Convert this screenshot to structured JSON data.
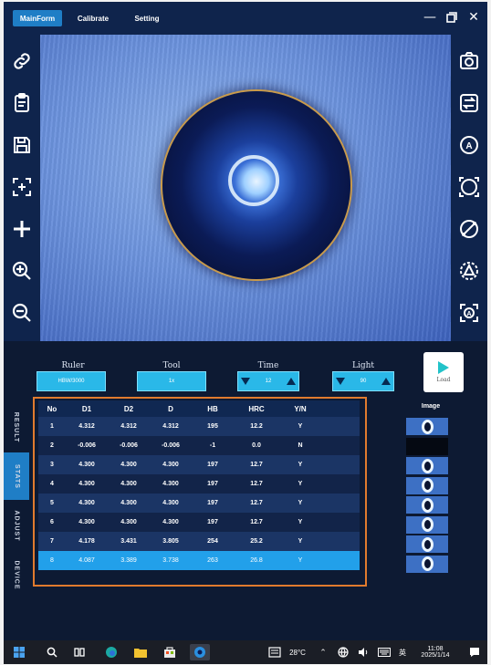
{
  "app": {
    "tabs": [
      "MainForm",
      "Calibrate",
      "Setting"
    ],
    "window_controls": [
      "minimize-icon",
      "maximize-icon",
      "close-icon"
    ]
  },
  "left_toolbar": [
    "link-icon",
    "clipboard-icon",
    "save-icon",
    "crosshair-fit-icon",
    "plus-icon",
    "zoom-in-icon",
    "zoom-out-icon"
  ],
  "right_toolbar": [
    "camera-icon",
    "swap-icon",
    "auto-measure-icon",
    "circle-fit-icon",
    "diameter-icon",
    "triangle-measure-icon",
    "auto-box-icon"
  ],
  "controls": {
    "ruler_label": "Ruler",
    "ruler_value": "HBW/3000",
    "tool_label": "Tool",
    "tool_value": "1x",
    "time_label": "Time",
    "time_value": "12",
    "light_label": "Light",
    "light_value": "90",
    "load_label": "Load"
  },
  "side_tabs": [
    "RESULT",
    "STATS",
    "ADJUST",
    "DEVICE"
  ],
  "table": {
    "headers": [
      "No",
      "D1",
      "D2",
      "D",
      "HB",
      "HRC",
      "Y/N"
    ],
    "rows": [
      [
        "1",
        "4.312",
        "4.312",
        "4.312",
        "195",
        "12.2",
        "Y"
      ],
      [
        "2",
        "-0.006",
        "-0.006",
        "-0.006",
        "-1",
        "0.0",
        "N"
      ],
      [
        "3",
        "4.300",
        "4.300",
        "4.300",
        "197",
        "12.7",
        "Y"
      ],
      [
        "4",
        "4.300",
        "4.300",
        "4.300",
        "197",
        "12.7",
        "Y"
      ],
      [
        "5",
        "4.300",
        "4.300",
        "4.300",
        "197",
        "12.7",
        "Y"
      ],
      [
        "6",
        "4.300",
        "4.300",
        "4.300",
        "197",
        "12.7",
        "Y"
      ],
      [
        "7",
        "4.178",
        "3.431",
        "3.805",
        "254",
        "25.2",
        "Y"
      ],
      [
        "8",
        "4.087",
        "3.389",
        "3.738",
        "263",
        "26.8",
        "Y"
      ]
    ],
    "selected_row": 8
  },
  "image_column": {
    "header": "Image",
    "thumbs": [
      "indent",
      "blank",
      "indent",
      "indent",
      "indent",
      "indent",
      "indent",
      "indent"
    ]
  },
  "taskbar": {
    "temperature": "28°C",
    "ime": "英",
    "time": "11:08",
    "date": "2025/1/14"
  },
  "colors": {
    "accent": "#1f7ec6",
    "selected_row": "#22a0ea",
    "control_box": "#2ab8e8",
    "highlight_frame": "#e07b2e"
  }
}
